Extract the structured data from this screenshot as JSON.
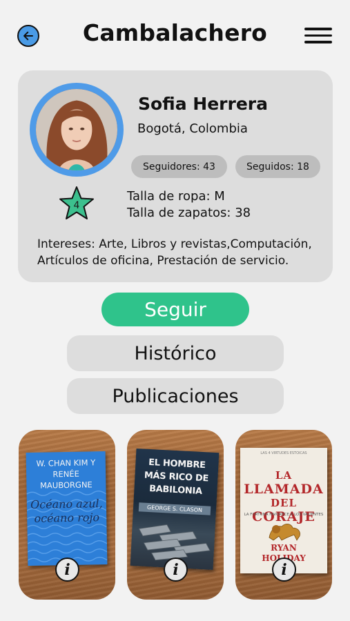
{
  "header": {
    "title": "Cambalachero",
    "back_icon": "arrow-left-icon",
    "menu_icon": "hamburger-menu-icon"
  },
  "profile": {
    "name": "Sofia Herrera",
    "location": "Bogotá, Colombia",
    "followers_label": "Seguidores: 43",
    "following_label": "Seguidos: 18",
    "rating": "4",
    "clothing_size": "Talla de ropa: M",
    "shoe_size": "Talla de zapatos: 38",
    "interests": "Intereses: Arte, Libros y revistas,Computación, Artículos de oficina, Prestación de servicio."
  },
  "actions": {
    "follow": "Seguir",
    "history": "Histórico",
    "posts": "Publicaciones"
  },
  "books": [
    {
      "author": "W. CHAN KIM Y RENÉE MAUBORGNE",
      "title": "Océano azul, océano rojo",
      "info_icon": "i"
    },
    {
      "title": "EL HOMBRE MÁS RICO DE BABILONIA",
      "author": "GEORGE S. CLASON",
      "info_icon": "i"
    },
    {
      "top_text": "LAS 4 VIRTUDES ESTOICAS",
      "title_line1": "LA",
      "title_line2": "LLAMADA",
      "title_line3": "DEL",
      "title_line4": "CORAJE",
      "subtitle": "LA FORTUNA FAVORECE A LOS VALIENTES",
      "author_line1": "RYAN",
      "author_line2": "HOLIDAY",
      "info_icon": "i"
    }
  ],
  "colors": {
    "accent_green": "#2fc38b",
    "avatar_ring": "#4f9be8",
    "card_bg": "#dddddd",
    "star_fill": "#3cc08e"
  }
}
